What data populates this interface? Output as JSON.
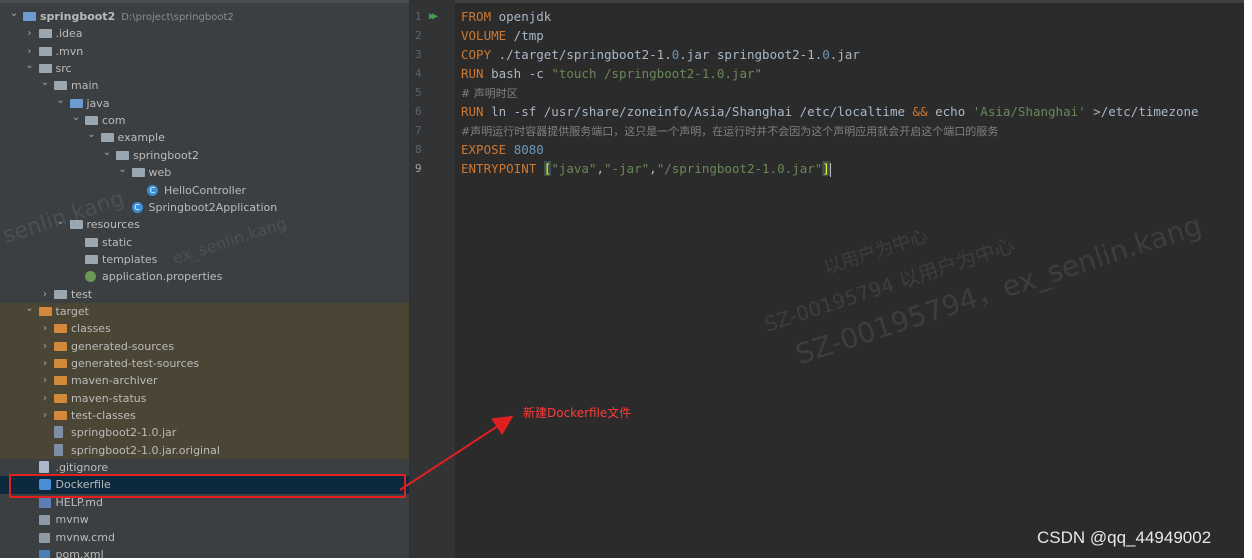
{
  "project": {
    "name": "springboot2",
    "path": "D:\\project\\springboot2"
  },
  "tree": [
    {
      "label": "springboot2",
      "indent": 0,
      "arrow": "v",
      "icon": "folder-blue",
      "root": true
    },
    {
      "label": ".idea",
      "indent": 1,
      "arrow": ">",
      "icon": "folder"
    },
    {
      "label": ".mvn",
      "indent": 1,
      "arrow": ">",
      "icon": "folder"
    },
    {
      "label": "src",
      "indent": 1,
      "arrow": "v",
      "icon": "folder"
    },
    {
      "label": "main",
      "indent": 2,
      "arrow": "v",
      "icon": "folder"
    },
    {
      "label": "java",
      "indent": 3,
      "arrow": "v",
      "icon": "folder-src"
    },
    {
      "label": "com",
      "indent": 4,
      "arrow": "v",
      "icon": "pkg"
    },
    {
      "label": "example",
      "indent": 5,
      "arrow": "v",
      "icon": "pkg"
    },
    {
      "label": "springboot2",
      "indent": 6,
      "arrow": "v",
      "icon": "pkg"
    },
    {
      "label": "web",
      "indent": 7,
      "arrow": "v",
      "icon": "pkg"
    },
    {
      "label": "HelloController",
      "indent": 8,
      "arrow": "",
      "icon": "cls"
    },
    {
      "label": "Springboot2Application",
      "indent": 7,
      "arrow": "",
      "icon": "cls"
    },
    {
      "label": "resources",
      "indent": 3,
      "arrow": "v",
      "icon": "folder"
    },
    {
      "label": "static",
      "indent": 4,
      "arrow": "",
      "icon": "folder"
    },
    {
      "label": "templates",
      "indent": 4,
      "arrow": "",
      "icon": "folder"
    },
    {
      "label": "application.properties",
      "indent": 4,
      "arrow": "",
      "icon": "prop"
    },
    {
      "label": "test",
      "indent": 2,
      "arrow": ">",
      "icon": "folder"
    },
    {
      "label": "target",
      "indent": 1,
      "arrow": "v",
      "icon": "folder-orange",
      "target": true
    },
    {
      "label": "classes",
      "indent": 2,
      "arrow": ">",
      "icon": "folder-orange",
      "target": true
    },
    {
      "label": "generated-sources",
      "indent": 2,
      "arrow": ">",
      "icon": "folder-orange",
      "target": true
    },
    {
      "label": "generated-test-sources",
      "indent": 2,
      "arrow": ">",
      "icon": "folder-orange",
      "target": true
    },
    {
      "label": "maven-archiver",
      "indent": 2,
      "arrow": ">",
      "icon": "folder-orange",
      "target": true
    },
    {
      "label": "maven-status",
      "indent": 2,
      "arrow": ">",
      "icon": "folder-orange",
      "target": true
    },
    {
      "label": "test-classes",
      "indent": 2,
      "arrow": ">",
      "icon": "folder-orange",
      "target": true
    },
    {
      "label": "springboot2-1.0.jar",
      "indent": 2,
      "arrow": "",
      "icon": "jar",
      "target": true
    },
    {
      "label": "springboot2-1.0.jar.original",
      "indent": 2,
      "arrow": "",
      "icon": "jar",
      "target": true
    },
    {
      "label": ".gitignore",
      "indent": 1,
      "arrow": "",
      "icon": "file"
    },
    {
      "label": "Dockerfile",
      "indent": 1,
      "arrow": "",
      "icon": "docker",
      "selected": true
    },
    {
      "label": "HELP.md",
      "indent": 1,
      "arrow": "",
      "icon": "md"
    },
    {
      "label": "mvnw",
      "indent": 1,
      "arrow": "",
      "icon": "mvn"
    },
    {
      "label": "mvnw.cmd",
      "indent": 1,
      "arrow": "",
      "icon": "mvn"
    },
    {
      "label": "pom.xml",
      "indent": 1,
      "arrow": "",
      "icon": "xml"
    }
  ],
  "editor": {
    "line_numbers": [
      "1",
      "2",
      "3",
      "4",
      "5",
      "6",
      "7",
      "8",
      "9"
    ],
    "current_line": "9",
    "lines": [
      [
        {
          "t": "FROM",
          "c": "kw"
        },
        {
          "t": " openjdk",
          "c": ""
        }
      ],
      [
        {
          "t": "VOLUME",
          "c": "kw"
        },
        {
          "t": " /tmp",
          "c": ""
        }
      ],
      [
        {
          "t": "COPY",
          "c": "kw"
        },
        {
          "t": " ./target/springboot2-1.",
          "c": ""
        },
        {
          "t": "0",
          "c": "num"
        },
        {
          "t": ".jar springboot2-1.",
          "c": ""
        },
        {
          "t": "0",
          "c": "num"
        },
        {
          "t": ".jar",
          "c": ""
        }
      ],
      [
        {
          "t": "RUN",
          "c": "kw"
        },
        {
          "t": " bash -c ",
          "c": ""
        },
        {
          "t": "\"touch /springboot2-1.0.jar\"",
          "c": "str"
        }
      ],
      [
        {
          "t": "# 声明时区",
          "c": "cm"
        }
      ],
      [
        {
          "t": "RUN",
          "c": "kw"
        },
        {
          "t": " ln -sf /usr/share/zoneinfo/Asia/Shanghai /etc/localtime ",
          "c": ""
        },
        {
          "t": "&&",
          "c": "kw"
        },
        {
          "t": " echo ",
          "c": ""
        },
        {
          "t": "'Asia/Shanghai'",
          "c": "str"
        },
        {
          "t": " >/etc/timezone",
          "c": ""
        }
      ],
      [
        {
          "t": "#声明运行时容器提供服务端口，这只是一个声明，在运行时并不会因为这个声明应用就会开启这个端口的服务",
          "c": "cm"
        }
      ],
      [
        {
          "t": "EXPOSE",
          "c": "kw"
        },
        {
          "t": " ",
          "c": ""
        },
        {
          "t": "8080",
          "c": "num"
        }
      ],
      [
        {
          "t": "ENTRYPOINT",
          "c": "kw"
        },
        {
          "t": " ",
          "c": ""
        },
        {
          "t": "[",
          "c": "br"
        },
        {
          "t": "\"java\"",
          "c": "str"
        },
        {
          "t": ",",
          "c": ""
        },
        {
          "t": "\"-jar\"",
          "c": "str"
        },
        {
          "t": ",",
          "c": ""
        },
        {
          "t": "\"/springboot2-1.0.jar\"",
          "c": "str"
        },
        {
          "t": "]",
          "c": "br"
        }
      ]
    ]
  },
  "annotation": {
    "text": "新建Dockerfile文件",
    "color": "#e02020"
  },
  "watermarks": [
    "以用户为中心",
    "SZ-00195794  以用户为中心",
    "SZ-00195794，ex_senlin.kang",
    "ex_senlin.kang",
    "senlin.kang"
  ],
  "credit": "CSDN @qq_44949002",
  "colors": {
    "keyword": "#cc7832",
    "string": "#6a8759",
    "number": "#6897bb",
    "comment": "#808080",
    "selection": "#0d293e",
    "target_bg": "#4b4535"
  }
}
